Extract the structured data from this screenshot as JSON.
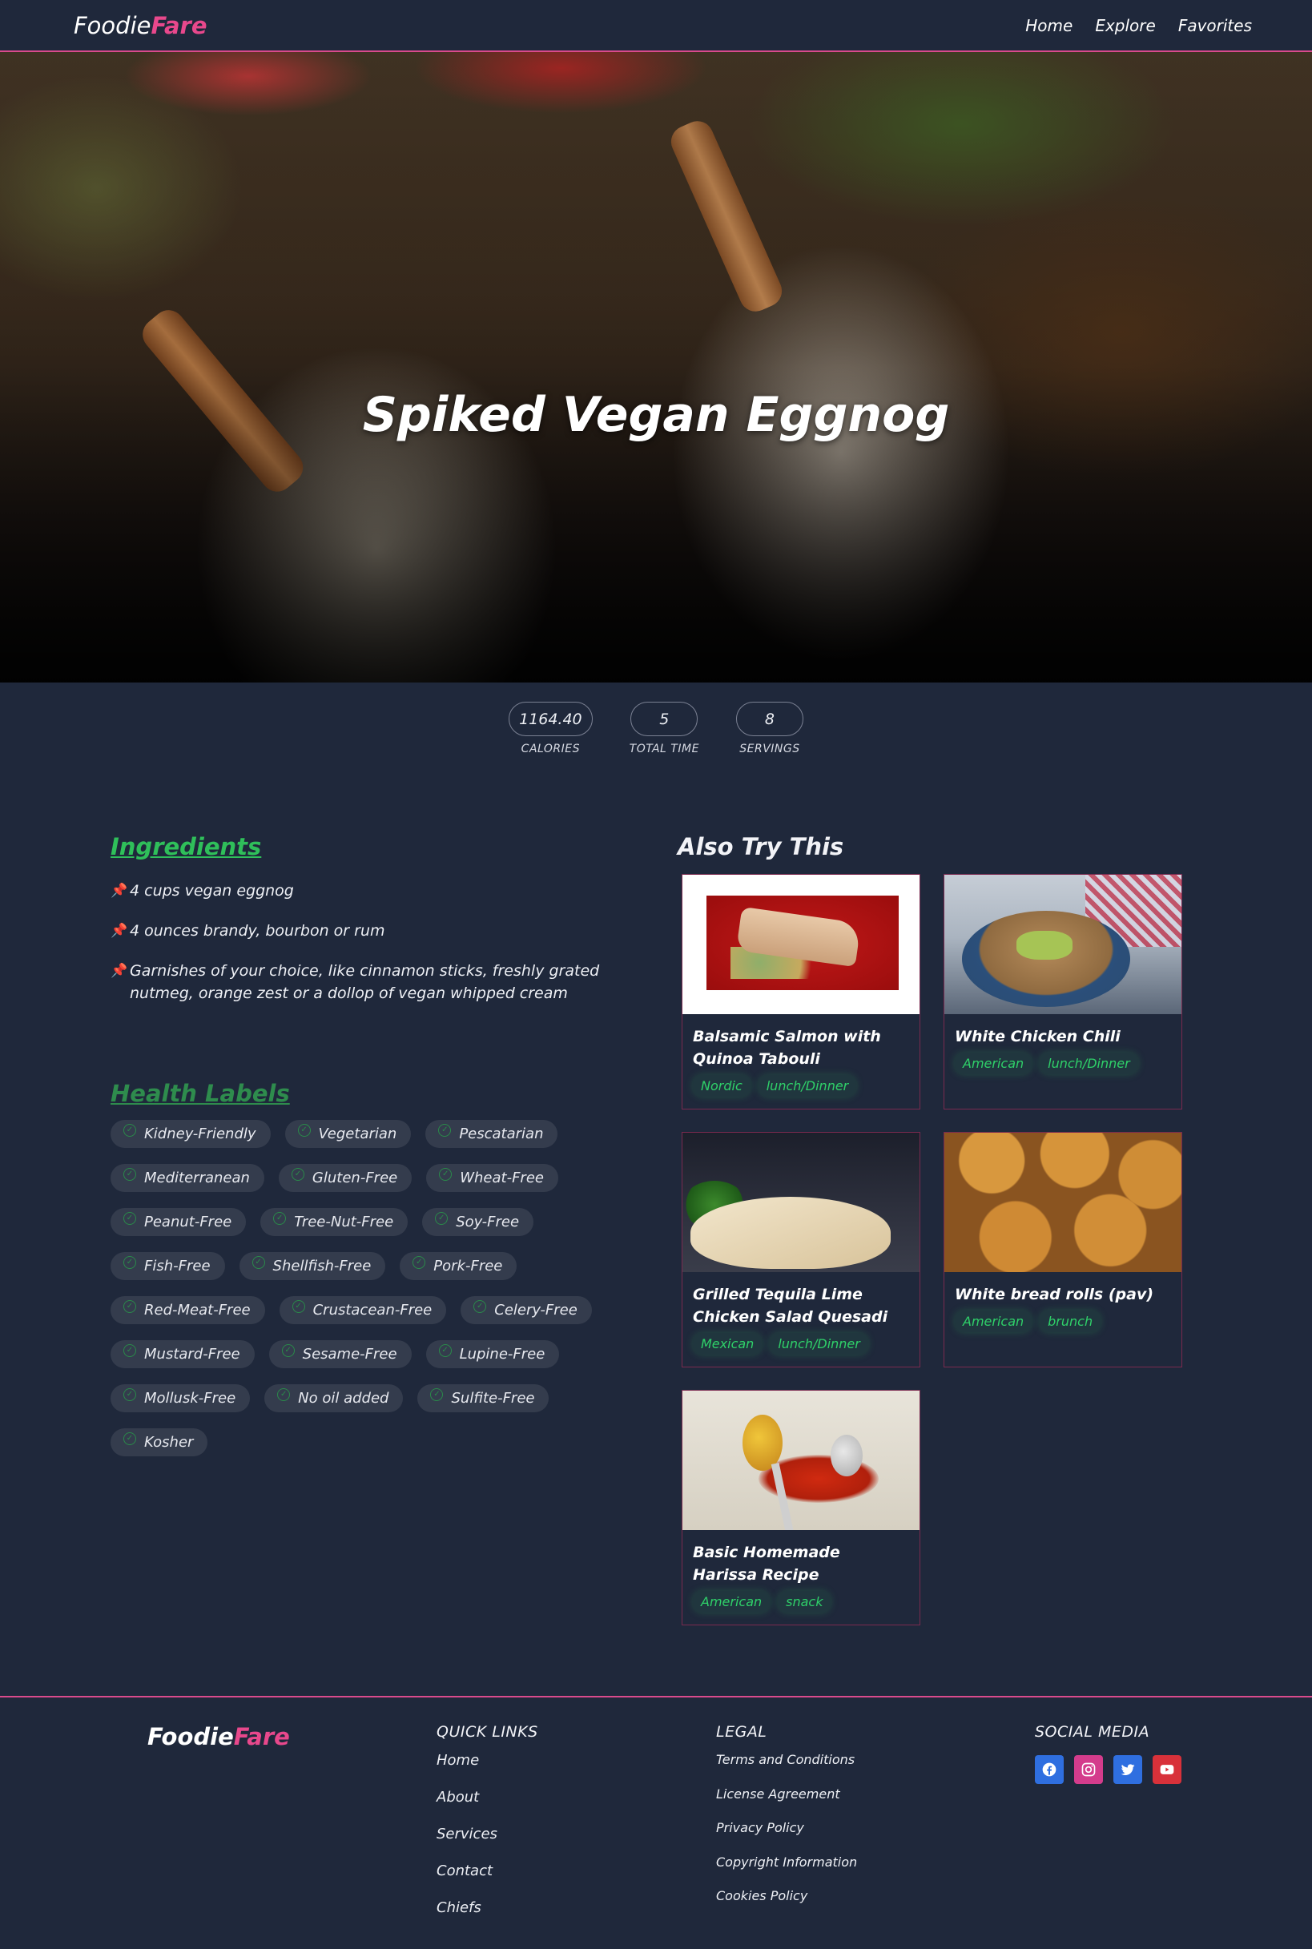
{
  "nav": {
    "logo_main": "Foodie",
    "logo_accent": "Fare",
    "links": [
      "Home",
      "Explore",
      "Favorites"
    ]
  },
  "hero": {
    "title": "Spiked Vegan Eggnog"
  },
  "stats": [
    {
      "value": "1164.40",
      "label": "CALORIES"
    },
    {
      "value": "5",
      "label": "TOTAL TIME"
    },
    {
      "value": "8",
      "label": "SERVINGS"
    }
  ],
  "ingredients": {
    "title": "Ingredients",
    "items": [
      "4 cups vegan eggnog",
      "4 ounces brandy, bourbon or rum",
      "Garnishes of your choice, like cinnamon sticks, freshly grated nutmeg, orange zest or a dollop of vegan whipped cream"
    ]
  },
  "health": {
    "title": "Health Labels",
    "labels": [
      "Kidney-Friendly",
      "Vegetarian",
      "Pescatarian",
      "Mediterranean",
      "Gluten-Free",
      "Wheat-Free",
      "Peanut-Free",
      "Tree-Nut-Free",
      "Soy-Free",
      "Fish-Free",
      "Shellfish-Free",
      "Pork-Free",
      "Red-Meat-Free",
      "Crustacean-Free",
      "Celery-Free",
      "Mustard-Free",
      "Sesame-Free",
      "Lupine-Free",
      "Mollusk-Free",
      "No oil added",
      "Sulfite-Free",
      "Kosher"
    ]
  },
  "also_try": {
    "title": "Also Try This",
    "cards": [
      {
        "title": "Balsamic Salmon with Quinoa Tabouli",
        "tags": [
          "Nordic",
          "lunch/Dinner"
        ]
      },
      {
        "title": "White Chicken Chili",
        "tags": [
          "American",
          "lunch/Dinner"
        ]
      },
      {
        "title": "Grilled Tequila Lime Chicken Salad Quesadi",
        "tags": [
          "Mexican",
          "lunch/Dinner"
        ]
      },
      {
        "title": "White bread rolls (pav)",
        "tags": [
          "American",
          "brunch"
        ]
      },
      {
        "title": "Basic Homemade Harissa Recipe",
        "tags": [
          "American",
          "snack"
        ]
      }
    ]
  },
  "footer": {
    "logo_main": "Foodie",
    "logo_accent": "Fare",
    "quick_links": {
      "title": "QUICK LINKS",
      "items": [
        "Home",
        "About",
        "Services",
        "Contact",
        "Chiefs"
      ]
    },
    "legal": {
      "title": "LEGAL",
      "items": [
        "Terms and Conditions",
        "License Agreement",
        "Privacy Policy",
        "Copyright Information",
        "Cookies Policy"
      ]
    },
    "social": {
      "title": "SOCIAL MEDIA",
      "icons": [
        "facebook-icon",
        "instagram-icon",
        "twitter-icon",
        "youtube-icon"
      ]
    }
  },
  "colors": {
    "background": "#1f283b",
    "accent_pink": "#e8488c",
    "green": "#2fbf5a",
    "card_border": "#7a2a4f"
  }
}
